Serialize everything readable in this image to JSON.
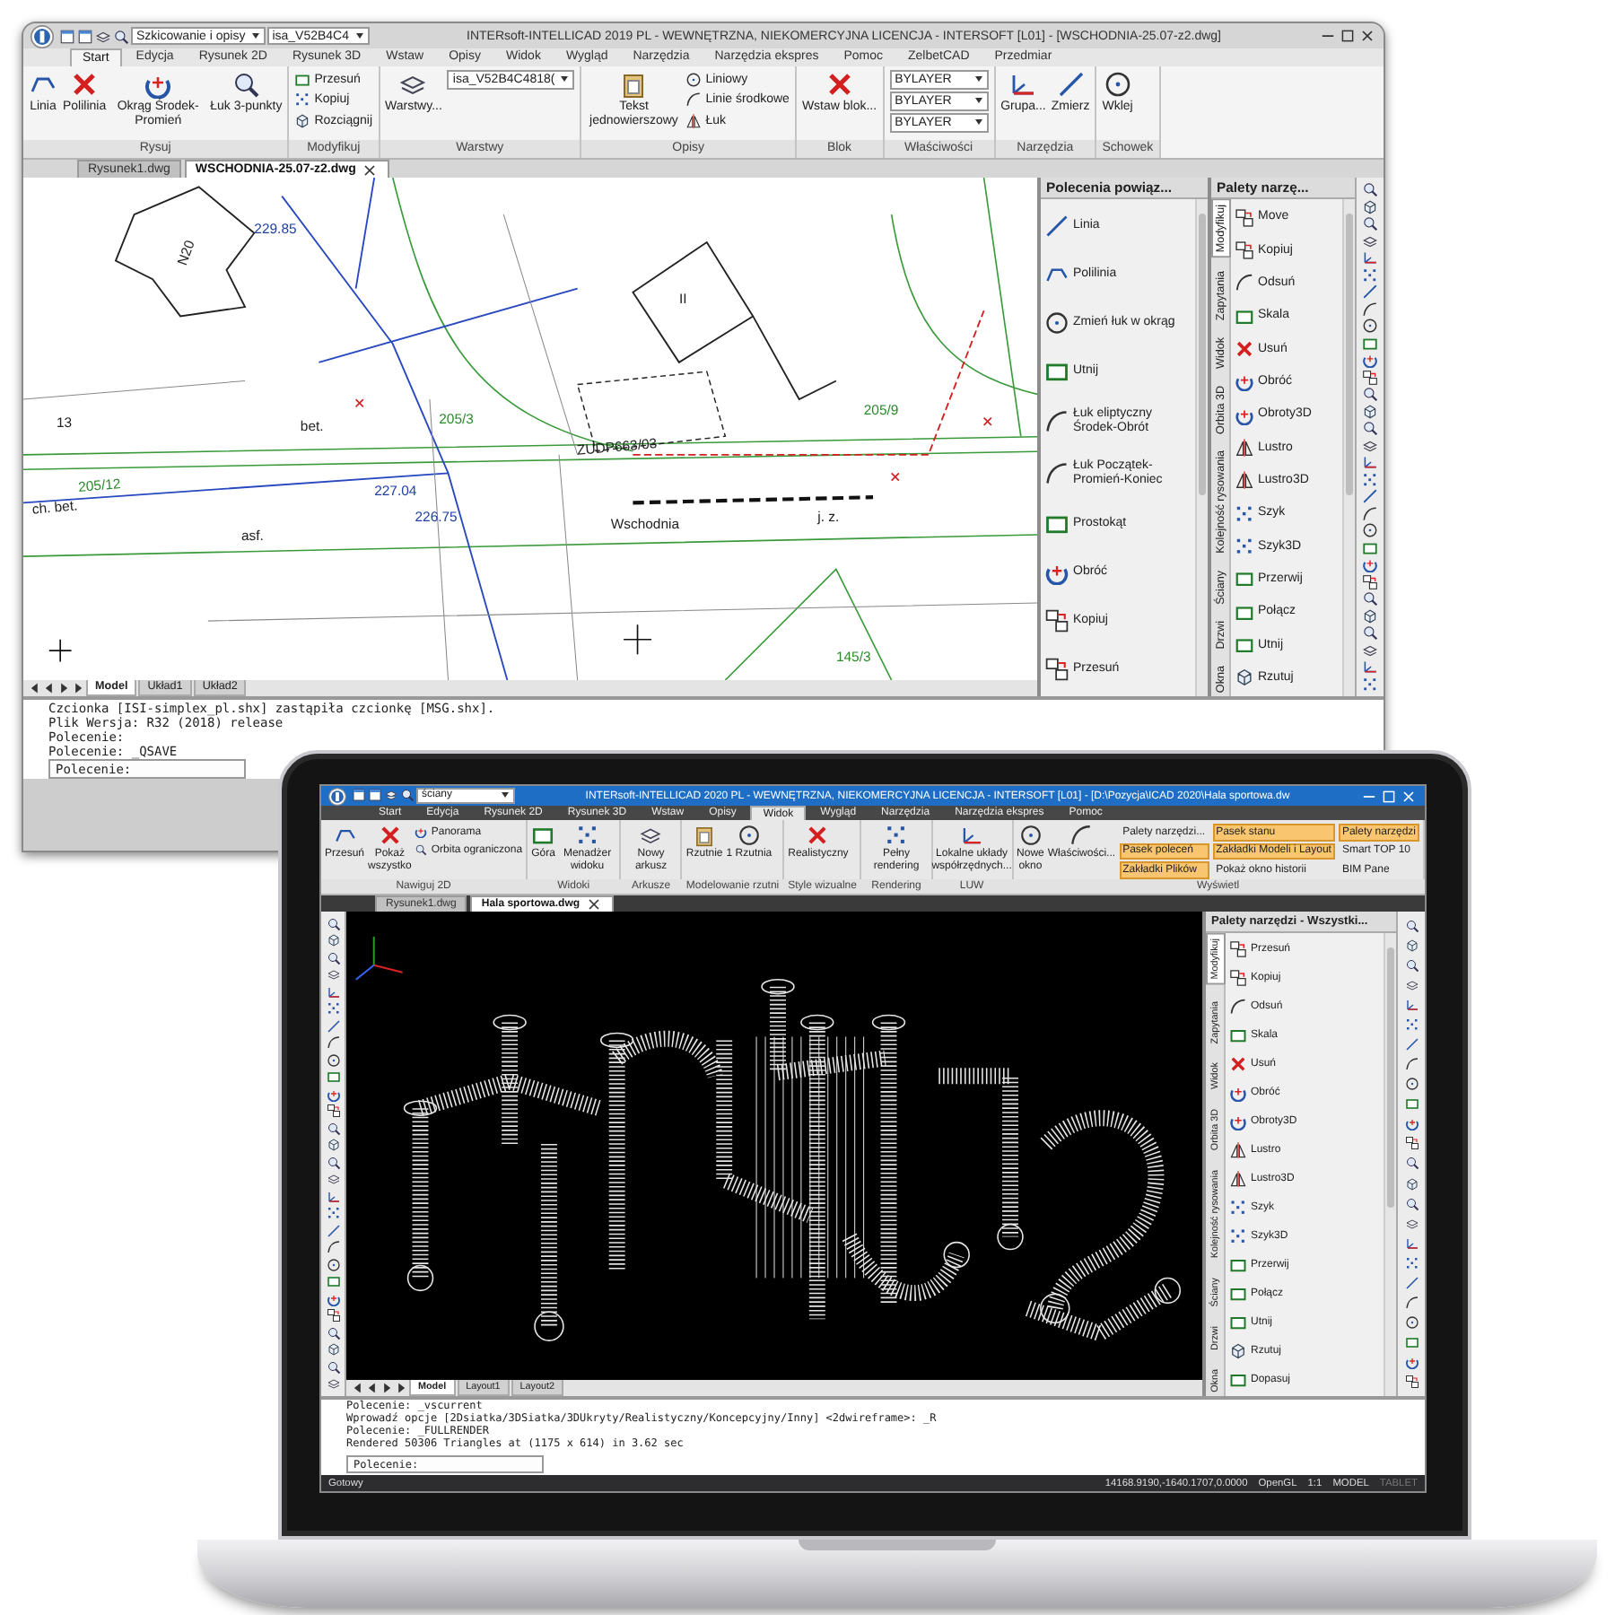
{
  "back_window": {
    "title": "INTERsoft-INTELLICAD 2019 PL - WEWNĘTRZNA, NIEKOMERCYJNA LICENCJA - INTERSOFT [L01] - [WSCHODNIA-25.07-z2.dwg]",
    "quick_access": {
      "workspace": "Szkicowanie i opisy",
      "layer": "isa_V52B4C4"
    },
    "menu_tabs": [
      {
        "label": "Start",
        "selected": true
      },
      {
        "label": "Edycja",
        "selected": false
      },
      {
        "label": "Rysunek 2D",
        "selected": false
      },
      {
        "label": "Rysunek 3D",
        "selected": false
      },
      {
        "label": "Wstaw",
        "selected": false
      },
      {
        "label": "Opisy",
        "selected": false
      },
      {
        "label": "Widok",
        "selected": false
      },
      {
        "label": "Wygląd",
        "selected": false
      },
      {
        "label": "Narzędzia",
        "selected": false
      },
      {
        "label": "Narzędzia ekspres",
        "selected": false
      },
      {
        "label": "Pomoc",
        "selected": false
      },
      {
        "label": "ZelbetCAD",
        "selected": false
      },
      {
        "label": "Przedmiar",
        "selected": false
      }
    ],
    "ribbon_groups": [
      {
        "title": "Rysuj",
        "buttons": [
          {
            "kind": "large",
            "label": "Linia"
          },
          {
            "kind": "large",
            "label": "Polilinia"
          },
          {
            "kind": "large",
            "label": "Okrąg Środek-Promień"
          },
          {
            "kind": "large",
            "label": "Łuk 3-punkty"
          }
        ]
      },
      {
        "title": "Modyfikuj",
        "buttons": [
          {
            "kind": "small",
            "label": "Przesuń"
          },
          {
            "kind": "small",
            "label": "Kopiuj"
          },
          {
            "kind": "small",
            "label": "Rozciągnij"
          }
        ]
      },
      {
        "title": "Warstwy",
        "buttons": [
          {
            "kind": "large",
            "label": "Warstwy..."
          },
          {
            "kind": "combo",
            "label": "isa_V52B4C4818("
          }
        ]
      },
      {
        "title": "Opisy",
        "buttons": [
          {
            "kind": "large",
            "label": "Tekst jednowierszowy"
          },
          {
            "kind": "small",
            "label": "Liniowy"
          },
          {
            "kind": "small",
            "label": "Linie środkowe"
          },
          {
            "kind": "small",
            "label": "Łuk"
          }
        ]
      },
      {
        "title": "Blok",
        "buttons": [
          {
            "kind": "large",
            "label": "Wstaw blok..."
          }
        ]
      },
      {
        "title": "Właściwości",
        "buttons": [
          {
            "kind": "combo",
            "label": "BYLAYER"
          },
          {
            "kind": "combo",
            "label": "BYLAYER"
          },
          {
            "kind": "combo",
            "label": "BYLAYER"
          }
        ]
      },
      {
        "title": "Narzędzia",
        "buttons": [
          {
            "kind": "large",
            "label": "Grupa..."
          },
          {
            "kind": "large",
            "label": "Zmierz"
          }
        ]
      },
      {
        "title": "Schowek",
        "buttons": [
          {
            "kind": "large",
            "label": "Wklej"
          }
        ]
      }
    ],
    "document_tabs": [
      {
        "label": "Rysunek1.dwg",
        "selected": false
      },
      {
        "label": "WSCHODNIA-25.07-z2.dwg",
        "selected": true
      }
    ],
    "drawing": {
      "kind": "site-plan",
      "labels": [
        "N20",
        "II",
        "bet.",
        "asf.",
        "13",
        "205/12",
        "205/9",
        "205/3",
        "ZUDP663/03",
        "Wschodnia",
        "j. z.",
        "145/3",
        "ch. bet.",
        "227.04",
        "226.75",
        "229.85"
      ]
    },
    "layout_tabs": [
      {
        "label": "Model",
        "selected": true
      },
      {
        "label": "Układ1",
        "selected": false
      },
      {
        "label": "Układ2",
        "selected": false
      }
    ],
    "palettes": [
      {
        "kind": "commands",
        "title": "Polecenia powiąz...",
        "items": [
          "Linia",
          "Polilinia",
          "Zmień łuk w okrąg",
          "Utnij",
          "Łuk eliptyczny Środek-Obrót",
          "Łuk Początek-Promień-Koniec",
          "Prostokąt",
          "Obróć",
          "Kopiuj",
          "Przesuń"
        ]
      },
      {
        "kind": "tools",
        "title": "Palety narzę...",
        "side_tabs": [
          {
            "label": "Modyfikuj",
            "selected": true
          },
          {
            "label": "Zapytania",
            "selected": false
          },
          {
            "label": "Widok",
            "selected": false
          },
          {
            "label": "Orbita 3D",
            "selected": false
          },
          {
            "label": "Kolejność rysowania",
            "selected": false
          },
          {
            "label": "Ściany",
            "selected": false
          },
          {
            "label": "Drzwi",
            "selected": false
          },
          {
            "label": "Okna",
            "selected": false
          }
        ],
        "items": [
          "Move",
          "Kopiuj",
          "Odsuń",
          "Skala",
          "Usuń",
          "Obróć",
          "Obroty3D",
          "Lustro",
          "Lustro3D",
          "Szyk",
          "Szyk3D",
          "Przerwij",
          "Połącz",
          "Utnij",
          "Rzutuj"
        ]
      }
    ],
    "command_history": [
      "Czcionka [ISI-simplex_pl.shx] zastąpiła czcionkę [MSG.shx].",
      "Plik Wersja: R32 (2018) release",
      "Polecenie:",
      "Polecenie: _QSAVE"
    ],
    "command_prompt": "Polecenie:"
  },
  "laptop_window": {
    "title": "INTERsoft-INTELLICAD 2020 PL - WEWNĘTRZNA, NIEKOMERCYJNA LICENCJA - INTERSOFT [L01] - [D:\\Pozycja\\ICAD 2020\\Hala sportowa.dw",
    "quick_access": {
      "layer": "ściany"
    },
    "menu_tabs": [
      {
        "label": "Start",
        "selected": false
      },
      {
        "label": "Edycja",
        "selected": false
      },
      {
        "label": "Rysunek 2D",
        "selected": false
      },
      {
        "label": "Rysunek 3D",
        "selected": false
      },
      {
        "label": "Wstaw",
        "selected": false
      },
      {
        "label": "Opisy",
        "selected": false
      },
      {
        "label": "Widok",
        "selected": true
      },
      {
        "label": "Wygląd",
        "selected": false
      },
      {
        "label": "Narzędzia",
        "selected": false
      },
      {
        "label": "Narzędzia ekspres",
        "selected": false
      },
      {
        "label": "Pomoc",
        "selected": false
      }
    ],
    "ribbon_groups": [
      {
        "title": "Nawiguj 2D",
        "buttons": [
          {
            "kind": "large",
            "label": "Przesuń"
          },
          {
            "kind": "large",
            "label": "Pokaż wszystko"
          },
          {
            "kind": "small",
            "label": "Panorama"
          },
          {
            "kind": "small",
            "label": "Orbita ograniczona"
          }
        ]
      },
      {
        "title": "Widoki",
        "buttons": [
          {
            "kind": "large",
            "label": "Góra"
          },
          {
            "kind": "large",
            "label": "Menadżer widoku"
          }
        ]
      },
      {
        "title": "Arkusze",
        "buttons": [
          {
            "kind": "large",
            "label": "Nowy arkusz"
          }
        ]
      },
      {
        "title": "Modelowanie rzutni",
        "buttons": [
          {
            "kind": "large",
            "label": "Rzutnie"
          },
          {
            "kind": "large",
            "label": "1 Rzutnia"
          }
        ]
      },
      {
        "title": "Style wizualne",
        "buttons": [
          {
            "kind": "large",
            "label": "Realistyczny"
          }
        ]
      },
      {
        "title": "Rendering",
        "buttons": [
          {
            "kind": "large",
            "label": "Pełny rendering"
          }
        ]
      },
      {
        "title": "LUW",
        "buttons": [
          {
            "kind": "large",
            "label": "Lokalne układy współrzędnych..."
          }
        ]
      },
      {
        "title": "Wyświetl",
        "buttons": [
          {
            "kind": "large",
            "label": "Nowe okno"
          },
          {
            "kind": "large",
            "label": "Właściwości..."
          },
          {
            "kind": "toggle",
            "label": "Palety narzędzi...",
            "on": false
          },
          {
            "kind": "toggle",
            "label": "Pasek poleceń",
            "on": true
          },
          {
            "kind": "toggle",
            "label": "Zakładki Plików",
            "on": true
          },
          {
            "kind": "toggle",
            "label": "Pasek stanu",
            "on": true
          },
          {
            "kind": "toggle",
            "label": "Zakładki Modeli i Layout",
            "on": true
          },
          {
            "kind": "toggle",
            "label": "Pokaż okno historii",
            "on": false
          },
          {
            "kind": "toggle",
            "label": "Palety narzędzi",
            "on": true
          },
          {
            "kind": "toggle",
            "label": "Smart TOP 10",
            "on": false
          },
          {
            "kind": "toggle",
            "label": "BIM Pane",
            "on": false
          }
        ]
      }
    ],
    "document_tabs": [
      {
        "label": "Rysunek1.dwg",
        "selected": false
      },
      {
        "label": "Hala sportowa.dwg",
        "selected": true
      }
    ],
    "drawing": {
      "kind": "wireframe-3d"
    },
    "layout_tabs": [
      {
        "label": "Model",
        "selected": true
      },
      {
        "label": "Layout1",
        "selected": false
      },
      {
        "label": "Layout2",
        "selected": false
      }
    ],
    "palettes": [
      {
        "kind": "tools",
        "title": "Palety narzędzi - Wszystki...",
        "side_tabs": [
          {
            "label": "Modyfikuj",
            "selected": true
          },
          {
            "label": "Zapytania",
            "selected": false
          },
          {
            "label": "Widok",
            "selected": false
          },
          {
            "label": "Orbita 3D",
            "selected": false
          },
          {
            "label": "Kolejność rysowania",
            "selected": false
          },
          {
            "label": "Ściany",
            "selected": false
          },
          {
            "label": "Drzwi",
            "selected": false
          },
          {
            "label": "Okna",
            "selected": false
          }
        ],
        "items": [
          "Przesuń",
          "Kopiuj",
          "Odsuń",
          "Skala",
          "Usuń",
          "Obróć",
          "Obroty3D",
          "Lustro",
          "Lustro3D",
          "Szyk",
          "Szyk3D",
          "Przerwij",
          "Połącz",
          "Utnij",
          "Rzutuj",
          "Dopasuj"
        ]
      }
    ],
    "command_history": [
      "Polecenie: _vscurrent",
      "Wprowadź opcje [2Dsiatka/3DSiatka/3DUkryty/Realistyczny/Koncepcyjny/Inny] <2dwireframe>: _R",
      "Polecenie: _FULLRENDER",
      "Rendered 50306 Triangles at (1175 x 614) in 3.62 sec"
    ],
    "command_prompt": "Polecenie:",
    "status_bar": {
      "status": "Gotowy",
      "coordinates": "14168.9190,-1640.1707,0.0000",
      "items": [
        {
          "label": "OpenGL",
          "on": true
        },
        {
          "label": "1:1",
          "on": true
        },
        {
          "label": "MODEL",
          "on": true
        },
        {
          "label": "TABLET",
          "on": false
        }
      ]
    }
  }
}
